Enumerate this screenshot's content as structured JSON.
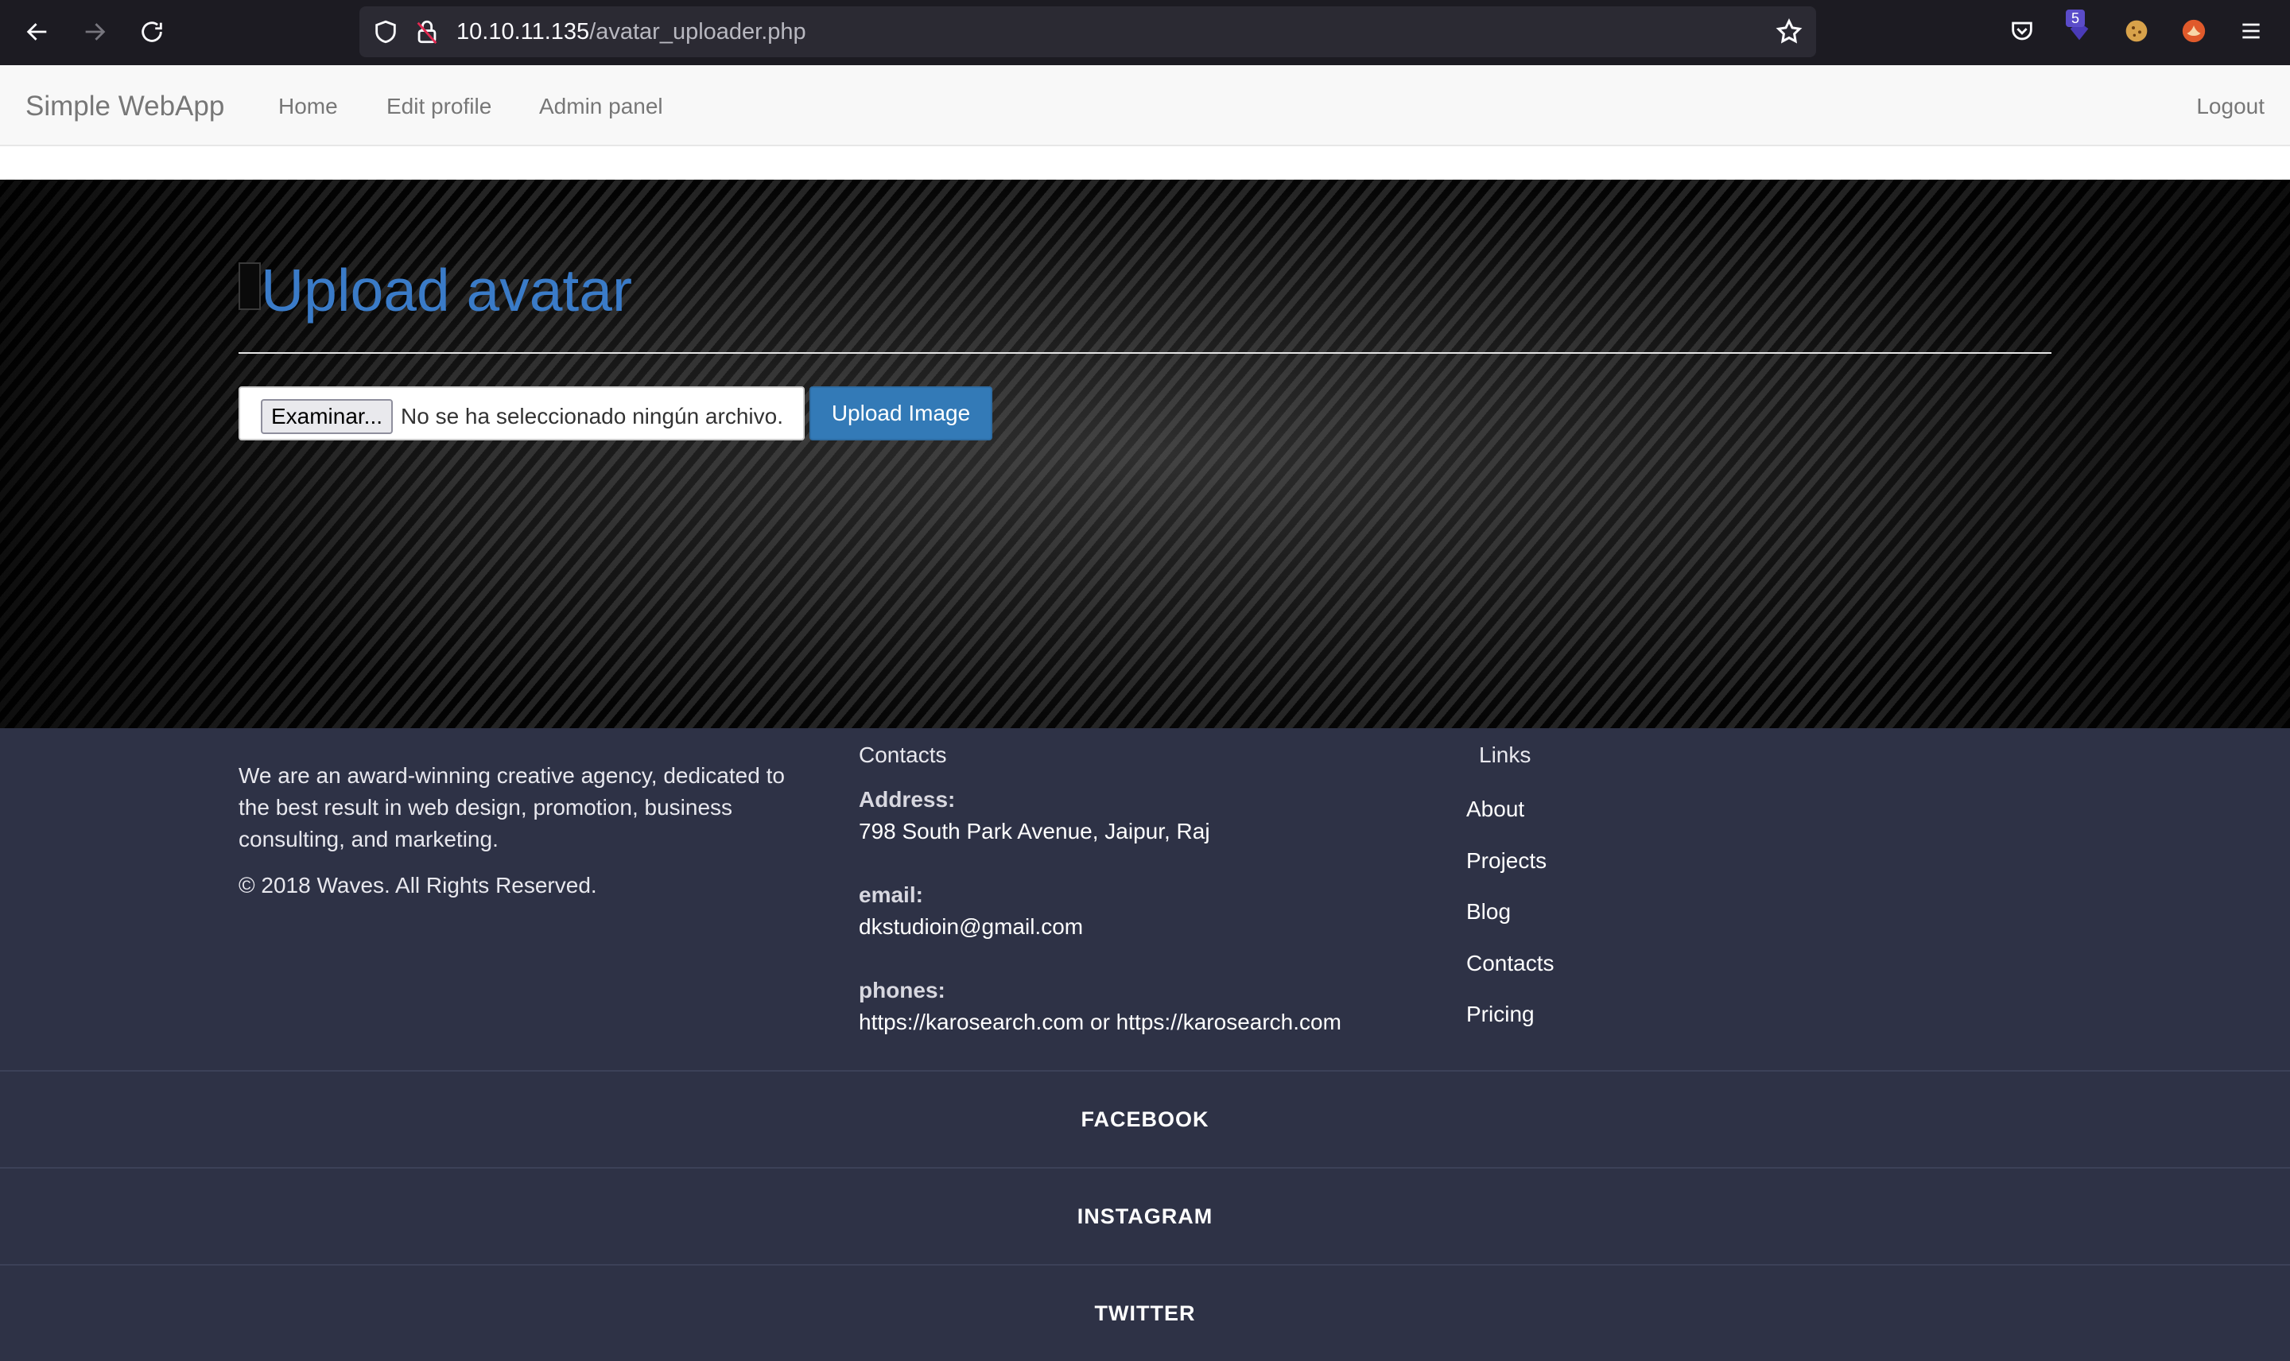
{
  "browser": {
    "url_host": "10.10.11.135",
    "url_path": "/avatar_uploader.php",
    "extension_badge": "5"
  },
  "navbar": {
    "brand": "Simple WebApp",
    "links": [
      "Home",
      "Edit profile",
      "Admin panel"
    ],
    "logout": "Logout"
  },
  "main": {
    "title": "Upload avatar",
    "file_button": "Examinar...",
    "file_status": "No se ha seleccionado ningún archivo.",
    "upload_button": "Upload Image"
  },
  "footer": {
    "about": "We are an award-winning creative agency, dedicated to the best result in web design, promotion, business consulting, and marketing.",
    "copyright": "©  2018 Waves. All Rights Reserved.",
    "contacts": {
      "title": "Contacts",
      "address_label": "Address:",
      "address": "798 South Park Avenue, Jaipur, Raj",
      "email_label": "email:",
      "email": "dkstudioin@gmail.com",
      "phones_label": "phones:",
      "phones": "https://karosearch.com or https://karosearch.com"
    },
    "links": {
      "title": "Links",
      "items": [
        "About",
        "Projects",
        "Blog",
        "Contacts",
        "Pricing"
      ]
    },
    "social": [
      "FACEBOOK",
      "INSTAGRAM",
      "TWITTER"
    ]
  },
  "colors": {
    "heading_blue": "#3a7bc8",
    "button_blue": "#337ab7",
    "footer_bg": "#2e3246",
    "chrome_bg": "#1c1b22"
  }
}
